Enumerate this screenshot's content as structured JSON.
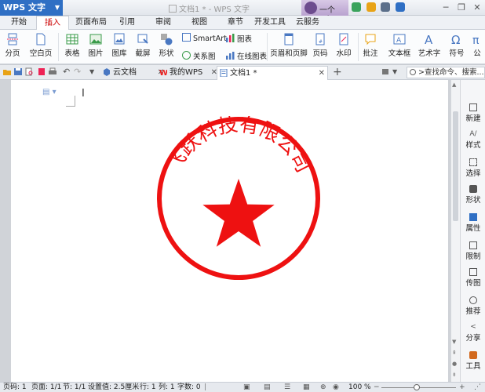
{
  "titlebar": {
    "app_name": "WPS 文字",
    "document_title": "文档1 * - WPS 文字",
    "user_name": "一个min"
  },
  "menu_tabs": [
    {
      "label": "开始"
    },
    {
      "label": "插入"
    },
    {
      "label": "页面布局"
    },
    {
      "label": "引用"
    },
    {
      "label": "审阅"
    },
    {
      "label": "视图"
    },
    {
      "label": "章节"
    },
    {
      "label": "开发工具"
    },
    {
      "label": "云服务"
    }
  ],
  "active_menu_tab": "插入",
  "ribbon": {
    "page_break": "分页",
    "blank_page": "空白页",
    "table": "表格",
    "picture": "图片",
    "gallery": "图库",
    "screenshot": "截屏",
    "shape": "形状",
    "smartart": "SmartArt",
    "relation_chart": "关系图",
    "chart": "图表",
    "online_chart": "在线图表",
    "header_footer": "页眉和页脚",
    "page_number": "页码",
    "watermark": "水印",
    "comment": "批注",
    "textbox": "文本框",
    "wordart": "艺术字",
    "symbol": "符号",
    "formula": "公"
  },
  "doc_tabs": [
    {
      "label": "云文档"
    },
    {
      "label": "我的WPS"
    },
    {
      "label": "文档1 *"
    }
  ],
  "search": {
    "placeholder": ">查找命令、搜索..."
  },
  "seal": {
    "text": "飞跃科技有限公司",
    "color": "#ee1111"
  },
  "sidebar": [
    {
      "label": "新建",
      "icon": "new-icon"
    },
    {
      "label": "样式",
      "icon": "style-icon"
    },
    {
      "label": "选择",
      "icon": "select-icon"
    },
    {
      "label": "形状",
      "icon": "shape-icon"
    },
    {
      "label": "属性",
      "icon": "property-icon"
    },
    {
      "label": "限制",
      "icon": "restrict-icon"
    },
    {
      "label": "传图",
      "icon": "upload-image-icon"
    },
    {
      "label": "推荐",
      "icon": "recommend-icon"
    },
    {
      "label": "分享",
      "icon": "share-icon"
    },
    {
      "label": "工具",
      "icon": "tools-icon"
    }
  ],
  "status": {
    "page_no": "页码: 1",
    "pages": "页面: 1/1",
    "section": "节: 1/1",
    "setting": "设置值: 2.5厘米",
    "line": "行: 1",
    "column": "列: 1",
    "word_count": "字数: 0",
    "zoom": "100 %"
  },
  "zoom_level": 1.0
}
